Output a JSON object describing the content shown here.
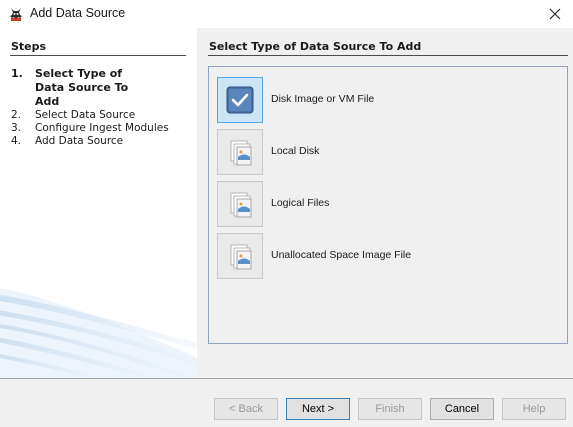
{
  "window": {
    "title": "Add Data Source",
    "icon": "autopsy-dog-icon",
    "close_icon": "close-icon"
  },
  "steps": {
    "header": "Steps",
    "items": [
      {
        "num": "1.",
        "label": "Select Type of Data Source To Add",
        "current": true
      },
      {
        "num": "2.",
        "label": "Select Data Source",
        "current": false
      },
      {
        "num": "3.",
        "label": "Configure Ingest Modules",
        "current": false
      },
      {
        "num": "4.",
        "label": "Add Data Source",
        "current": false
      }
    ]
  },
  "main": {
    "header": "Select Type of Data Source To Add",
    "options": [
      {
        "label": "Disk Image or VM File",
        "icon": "disk-image-icon",
        "selected": true
      },
      {
        "label": "Local Disk",
        "icon": "local-disk-icon",
        "selected": false
      },
      {
        "label": "Logical Files",
        "icon": "logical-files-icon",
        "selected": false
      },
      {
        "label": "Unallocated Space Image File",
        "icon": "unallocated-image-icon",
        "selected": false
      }
    ]
  },
  "buttons": {
    "back": "< Back",
    "next": "Next >",
    "finish": "Finish",
    "cancel": "Cancel",
    "help": "Help"
  },
  "colors": {
    "selection_border": "#5aa4dc",
    "selection_fill": "#cde6f7",
    "panel_bg": "#f0f0f0",
    "box_border": "#8ea3bd"
  }
}
